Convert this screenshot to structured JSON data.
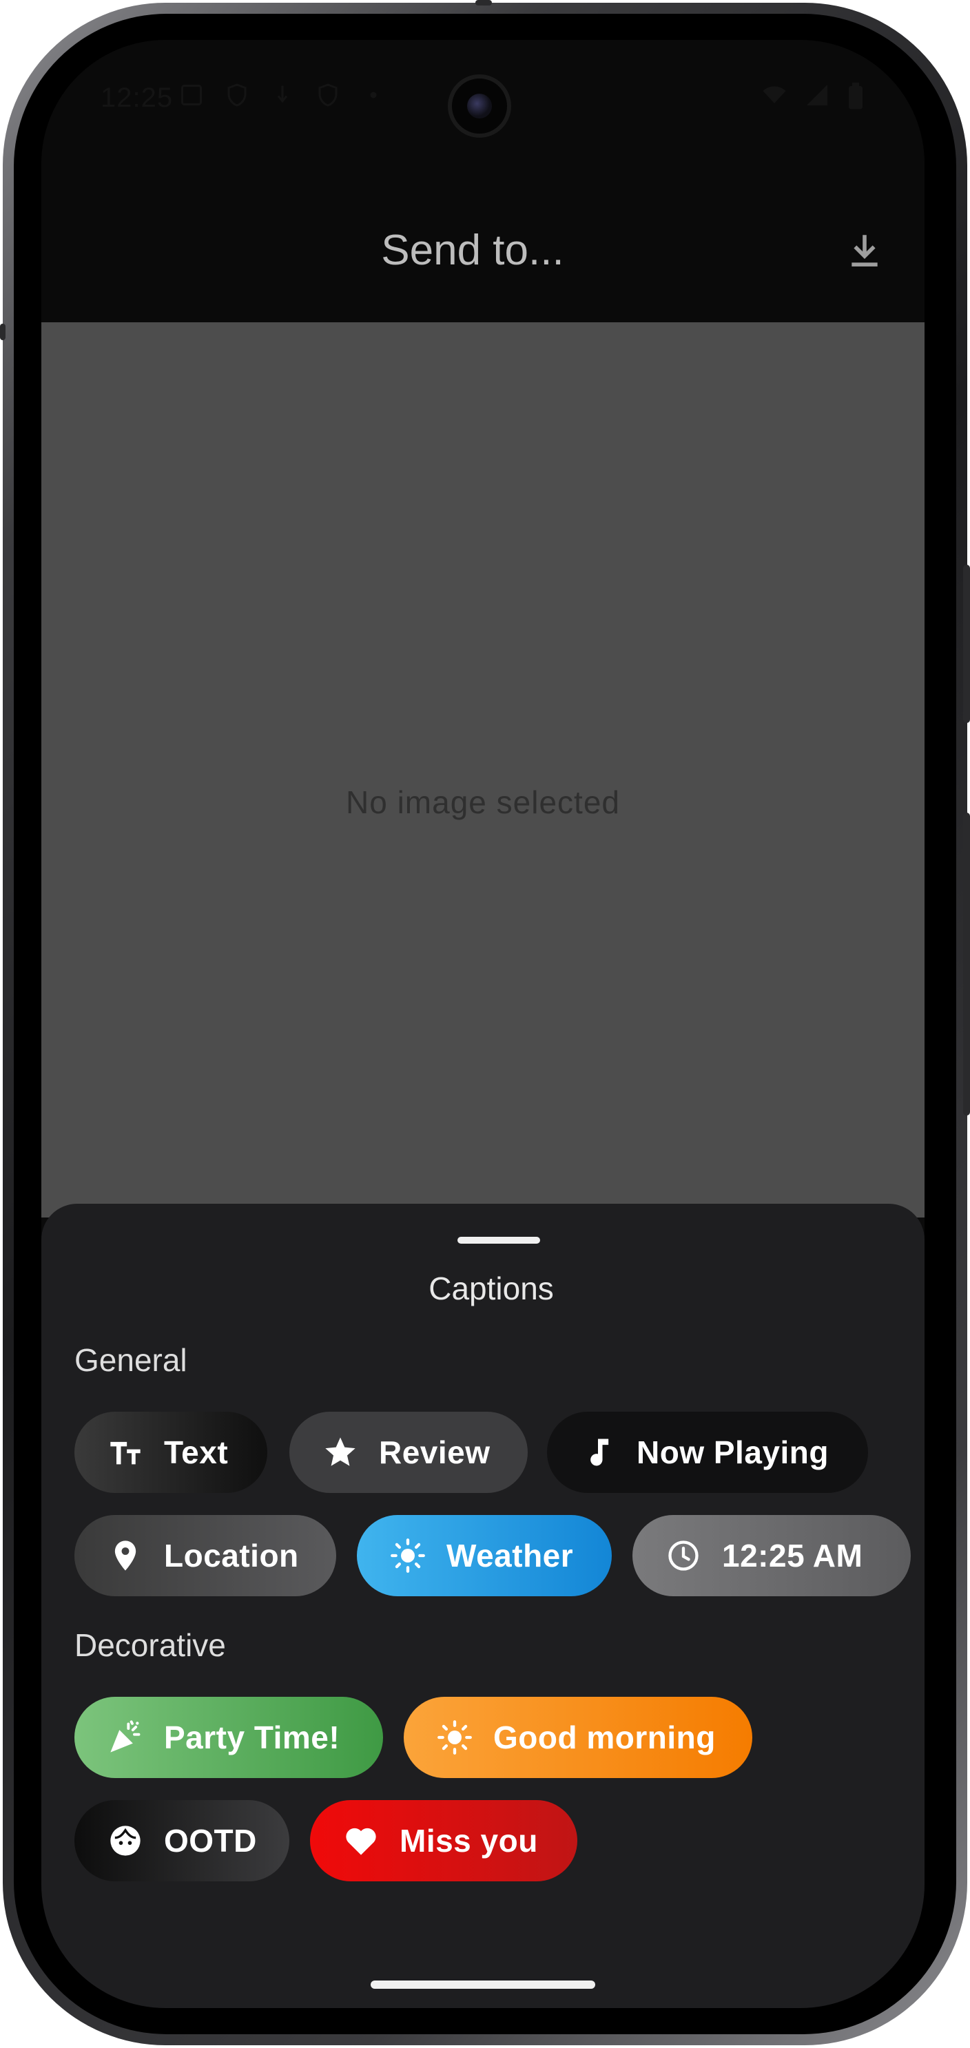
{
  "status_bar": {
    "time": "12:25"
  },
  "app_bar": {
    "title": "Send to...",
    "download_icon": "download-icon"
  },
  "preview": {
    "empty_text": "No image selected"
  },
  "sheet": {
    "title": "Captions",
    "sections": {
      "general": "General",
      "decorative": "Decorative"
    },
    "chips": {
      "text": {
        "label": "Text",
        "icon": "text-size-icon"
      },
      "review": {
        "label": "Review",
        "icon": "star-icon"
      },
      "now_playing": {
        "label": "Now Playing",
        "icon": "music-note-icon"
      },
      "location": {
        "label": "Location",
        "icon": "location-pin-icon"
      },
      "weather": {
        "label": "Weather",
        "icon": "sun-icon"
      },
      "time": {
        "label": "12:25 AM",
        "icon": "clock-icon"
      },
      "party": {
        "label": "Party Time!",
        "icon": "party-popper-icon"
      },
      "good_morning": {
        "label": "Good morning",
        "icon": "sun-icon"
      },
      "ootd": {
        "label": "OOTD",
        "icon": "face-icon"
      },
      "miss_you": {
        "label": "Miss you",
        "icon": "heart-icon"
      }
    }
  },
  "colors": {
    "weather_chip": "#2ea3e8",
    "party_chip": "#5cb85c",
    "good_morning_chip": "#fb8c00",
    "miss_you_chip": "#e01010",
    "sheet_background": "#1e1e20",
    "preview_background": "#4d4d4d"
  }
}
